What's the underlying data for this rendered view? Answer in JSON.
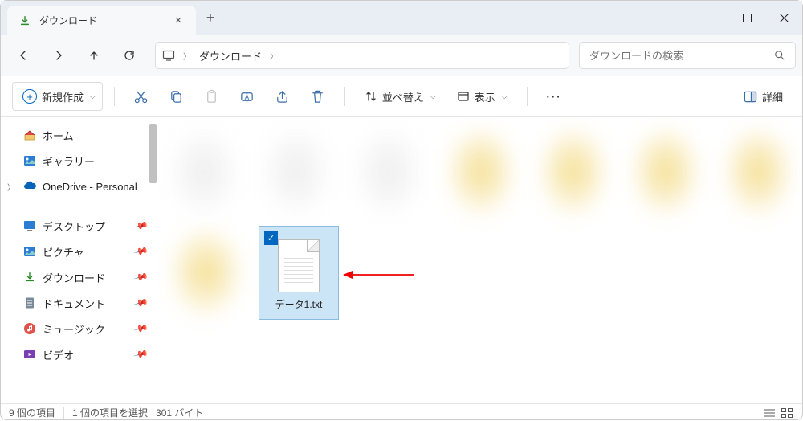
{
  "tab": {
    "title": "ダウンロード"
  },
  "address": {
    "current": "ダウンロード"
  },
  "search": {
    "placeholder": "ダウンロードの検索"
  },
  "toolbar": {
    "new_label": "新規作成",
    "sort_label": "並べ替え",
    "view_label": "表示",
    "details_label": "詳細"
  },
  "sidebar": {
    "home": "ホーム",
    "gallery": "ギャラリー",
    "onedrive": "OneDrive - Personal",
    "desktop": "デスクトップ",
    "pictures": "ピクチャ",
    "downloads": "ダウンロード",
    "documents": "ドキュメント",
    "music": "ミュージック",
    "videos": "ビデオ"
  },
  "files": {
    "selected": {
      "name": "データ1.txt"
    }
  },
  "status": {
    "count": "9 個の項目",
    "selected": "1 個の項目を選択",
    "size": "301 バイト"
  }
}
